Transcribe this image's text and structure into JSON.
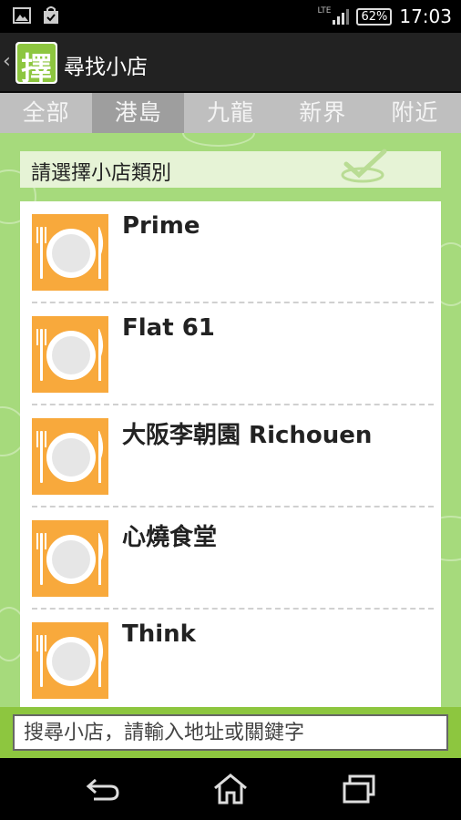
{
  "status_bar": {
    "network": "LTE",
    "battery": "62%",
    "time": "17:03",
    "icons": [
      "image-icon",
      "shopping-bag-check-icon",
      "signal-icon",
      "battery-icon"
    ]
  },
  "action_bar": {
    "title": "尋找小店",
    "logo_glyph": "擇",
    "back_icon": "chevron-left-icon"
  },
  "tabs": [
    {
      "label": "全部",
      "active": false
    },
    {
      "label": "港島",
      "active": true
    },
    {
      "label": "九龍",
      "active": false
    },
    {
      "label": "新界",
      "active": false
    },
    {
      "label": "附近",
      "active": false
    }
  ],
  "category": {
    "label": "請選擇小店類別",
    "icon": "checkmark-icon"
  },
  "shops": [
    {
      "name": "Prime",
      "icon": "plate-fork-knife-icon"
    },
    {
      "name": "Flat 61",
      "icon": "plate-fork-knife-icon"
    },
    {
      "name": "大阪李朝園 Richouen",
      "icon": "plate-fork-knife-icon"
    },
    {
      "name": "心燒食堂",
      "icon": "plate-fork-knife-icon"
    },
    {
      "name": "Think",
      "icon": "plate-fork-knife-icon"
    }
  ],
  "search": {
    "placeholder": "搜尋小店，請輸入地址或關鍵字"
  },
  "nav": {
    "back_icon": "back-arrow-icon",
    "home_icon": "home-icon",
    "recents_icon": "recent-apps-icon"
  },
  "colors": {
    "accent_green": "#8dc63f",
    "background_green": "#a6da7c",
    "plate_orange": "#f8a93c"
  }
}
